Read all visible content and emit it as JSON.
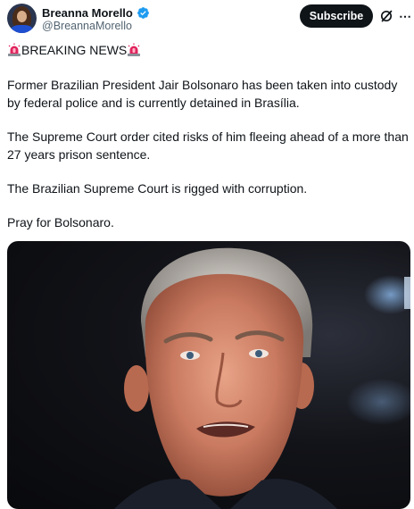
{
  "author": {
    "display_name": "Breanna Morello",
    "handle": "@BreannaMorello",
    "verified": true
  },
  "actions": {
    "subscribe_label": "Subscribe",
    "grok_icon": "grok-slash-icon",
    "more_icon": "more-options-icon"
  },
  "post": {
    "headline": "BREAKING NEWS",
    "paragraphs": [
      "Former Brazilian President Jair Bolsonaro has been taken into custody by federal police and is currently detained in Brasília.",
      "The Supreme Court order cited risks of him fleeing ahead of a more than 27 years prison sentence.",
      "The Brazilian Supreme Court is rigged with corruption.",
      "Pray for Bolsonaro."
    ]
  },
  "colors": {
    "text": "#0f1419",
    "muted": "#536471",
    "verified_blue": "#1d9bf0",
    "siren_red": "#e0245e",
    "button_bg": "#0f1419"
  }
}
